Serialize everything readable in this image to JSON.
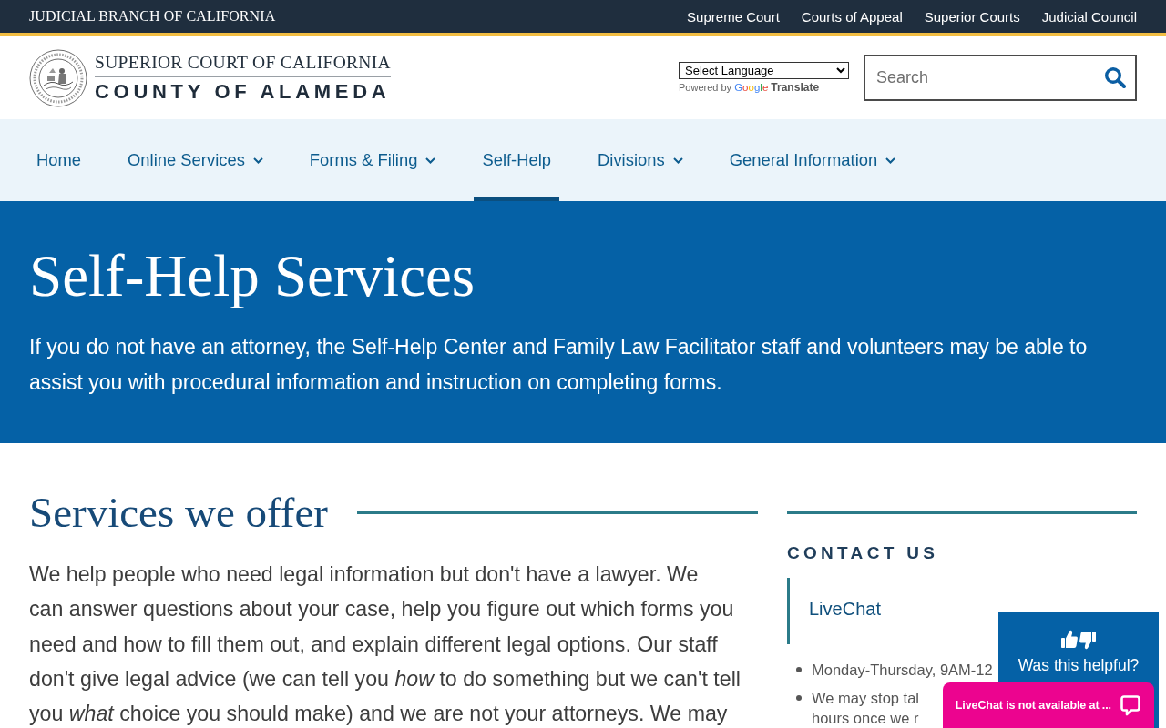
{
  "top_bar": {
    "title": "JUDICIAL BRANCH OF CALIFORNIA",
    "links": [
      "Supreme Court",
      "Courts of Appeal",
      "Superior Courts",
      "Judicial Council"
    ]
  },
  "header": {
    "logo": {
      "line_1": "SUPERIOR COURT OF CALIFORNIA",
      "line_2": "COUNTY OF ALAMEDA"
    },
    "language_select": {
      "value": "Select Language",
      "powered_by": "Powered by",
      "brand": "Google",
      "service": "Translate"
    },
    "search": {
      "placeholder": "Search"
    }
  },
  "nav": [
    {
      "label": "Home",
      "has_menu": false,
      "selected": false
    },
    {
      "label": "Online Services",
      "has_menu": true,
      "selected": false
    },
    {
      "label": "Forms & Filing",
      "has_menu": true,
      "selected": false
    },
    {
      "label": "Self-Help",
      "has_menu": false,
      "selected": true
    },
    {
      "label": "Divisions",
      "has_menu": true,
      "selected": false
    },
    {
      "label": "General Information",
      "has_menu": true,
      "selected": false
    }
  ],
  "hero": {
    "title": "Self-Help Services",
    "text": "If you do not have an attorney, the Self-Help Center and Family Law Facilitator staff and volunteers may be able to assist you with procedural information and instruction on completing forms."
  },
  "main": {
    "heading": "Services we offer",
    "paragraph": "We help people who need legal information but don't have a lawyer. We\ncan answer questions about your case, help you figure out which forms you\nneed and how to fill them out, and explain different legal options. Our staff\ndon't give legal advice (we can tell you *how* to do something but we can't tell\nyou *what* choice you should make) and we are not your attorneys. We may"
  },
  "sidebar": {
    "heading": "CONTACT US",
    "card": {
      "title": "LiveChat"
    },
    "items": [
      "Monday-Thursday, 9AM-12",
      "We may stop tal\nhours once we r"
    ]
  },
  "feedback_widget": {
    "label": "Was this helpful?"
  },
  "chat_bar": {
    "label": "LiveChat is not available at ..."
  }
}
